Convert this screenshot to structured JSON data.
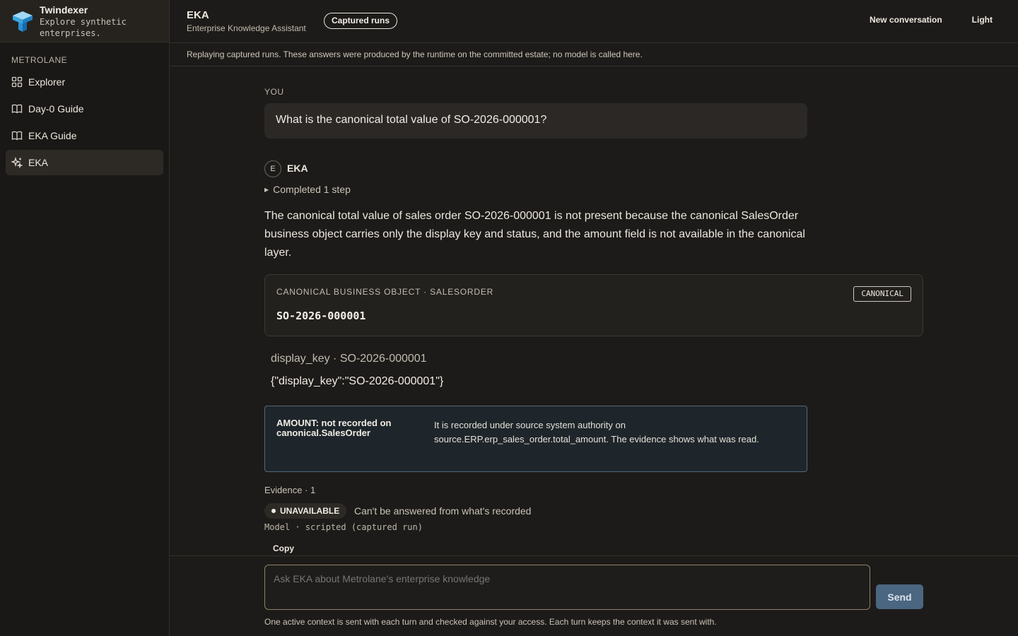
{
  "brand": {
    "name": "Twindexer",
    "tagline": "Explore synthetic enterprises."
  },
  "sidebar": {
    "section_label": "METROLANE",
    "items": [
      {
        "label": "Explorer",
        "icon": "grid-icon",
        "active": false
      },
      {
        "label": "Day-0 Guide",
        "icon": "book-icon",
        "active": false
      },
      {
        "label": "EKA Guide",
        "icon": "book-icon",
        "active": false
      },
      {
        "label": "EKA",
        "icon": "sparkle-icon",
        "active": true
      }
    ]
  },
  "header": {
    "title": "EKA",
    "subtitle": "Enterprise Knowledge Assistant",
    "badge": "Captured runs",
    "new_conversation": "New conversation",
    "theme_toggle": "Light"
  },
  "notice": "Replaying captured runs. These answers were produced by the runtime on the committed estate; no model is called here.",
  "conversation": {
    "you_label": "YOU",
    "question": "What is the canonical total value of SO-2026-000001?",
    "assistant_avatar": "E",
    "assistant_name": "EKA",
    "steps": "Completed 1 step",
    "answer": "The canonical total value of sales order SO-2026-000001 is not present because the canonical SalesOrder business object carries only the display key and status, and the amount field is not available in the canonical layer.",
    "card": {
      "kicker": "CANONICAL BUSINESS OBJECT · SALESORDER",
      "key": "SO-2026-000001",
      "tag": "CANONICAL"
    },
    "field_line": "display_key · SO-2026-000001",
    "field_json": "{\"display_key\":\"SO-2026-000001\"}",
    "note": {
      "title": "AMOUNT: not recorded on canonical.SalesOrder",
      "body": "It is recorded under source system authority on source.ERP.erp_sales_order.total_amount. The evidence shows what was read."
    },
    "evidence": "Evidence · 1",
    "status_label": "UNAVAILABLE",
    "status_text": "Can't be answered from what's recorded",
    "model_line": "Model · scripted (captured run)",
    "copy_label": "Copy"
  },
  "composer": {
    "placeholder": "Ask EKA about Metrolane's enterprise knowledge",
    "send_label": "Send",
    "note": "One active context is sent with each turn and checked against your access. Each turn keeps the context it was sent with."
  },
  "colors": {
    "background": "#1d1b19",
    "sidebar": "#1a1816",
    "accent_blue": "#4a6681",
    "note_border": "#4f6a7d",
    "input_border": "#8e8067"
  }
}
